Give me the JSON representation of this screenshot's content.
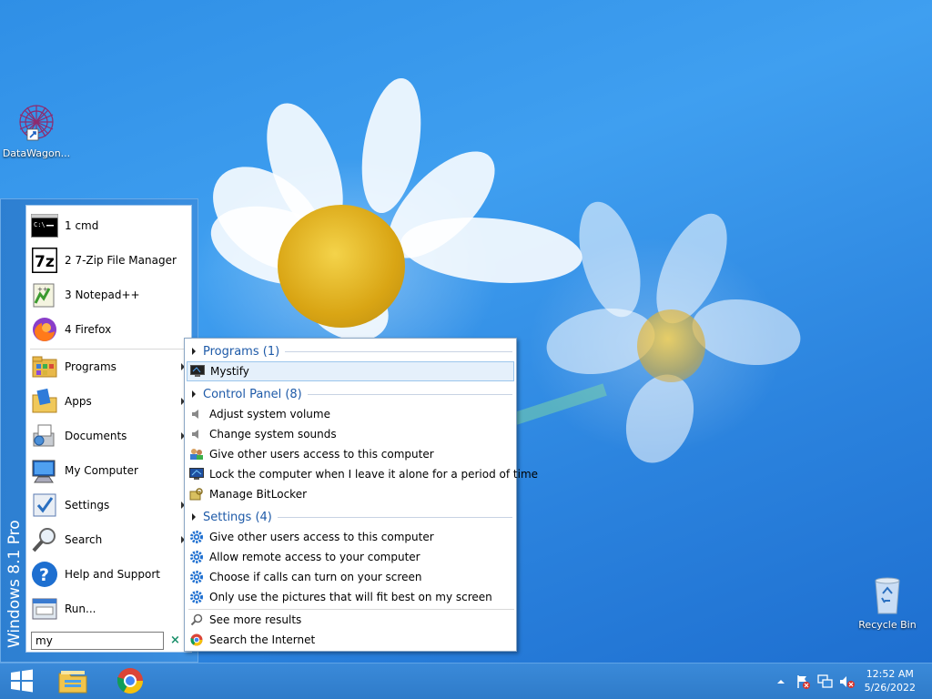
{
  "desktop": {
    "icons": [
      {
        "label": "DataWagon...",
        "icon": "datawagon-icon"
      },
      {
        "label": "Recycle Bin",
        "icon": "recycle-bin-icon"
      }
    ]
  },
  "start_menu": {
    "banner": "Windows 8.1 Pro",
    "recent": [
      {
        "label": "1 cmd",
        "icon": "cmd-icon"
      },
      {
        "label": "2 7-Zip File Manager",
        "icon": "7zip-icon"
      },
      {
        "label": "3 Notepad++",
        "icon": "notepadpp-icon"
      },
      {
        "label": "4 Firefox",
        "icon": "firefox-icon"
      }
    ],
    "items": [
      {
        "label": "Programs",
        "icon": "programs-folder-icon"
      },
      {
        "label": "Apps",
        "icon": "apps-folder-icon"
      },
      {
        "label": "Documents",
        "icon": "documents-icon"
      },
      {
        "label": "My Computer",
        "icon": "computer-icon"
      },
      {
        "label": "Settings",
        "icon": "settings-icon"
      },
      {
        "label": "Search",
        "icon": "search-icon"
      },
      {
        "label": "Help and Support",
        "icon": "help-icon"
      },
      {
        "label": "Run...",
        "icon": "run-icon"
      }
    ],
    "search_value": "my",
    "clear_glyph": "×"
  },
  "results": {
    "programs_header": "Programs (1)",
    "programs": [
      {
        "label": "Mystify"
      }
    ],
    "control_panel_header": "Control Panel (8)",
    "control_panel": [
      {
        "label": "Adjust system volume"
      },
      {
        "label": "Change system sounds"
      },
      {
        "label": "Give other users access to this computer"
      },
      {
        "label": "Lock the computer when I leave it alone for a period of time"
      },
      {
        "label": "Manage BitLocker"
      }
    ],
    "settings_header": "Settings (4)",
    "settings": [
      {
        "label": "Give other users access to this computer"
      },
      {
        "label": "Allow remote access to your computer"
      },
      {
        "label": "Choose if calls can turn on your screen"
      },
      {
        "label": "Only use the pictures that will fit best on my screen"
      }
    ],
    "see_more": "See more results",
    "search_internet": "Search the Internet"
  },
  "taskbar": {
    "time": "12:52 AM",
    "date": "5/26/2022"
  },
  "colors": {
    "accent": "#2f7bc9",
    "header_text": "#1e5aa8",
    "selection": "#e5f0fb"
  }
}
